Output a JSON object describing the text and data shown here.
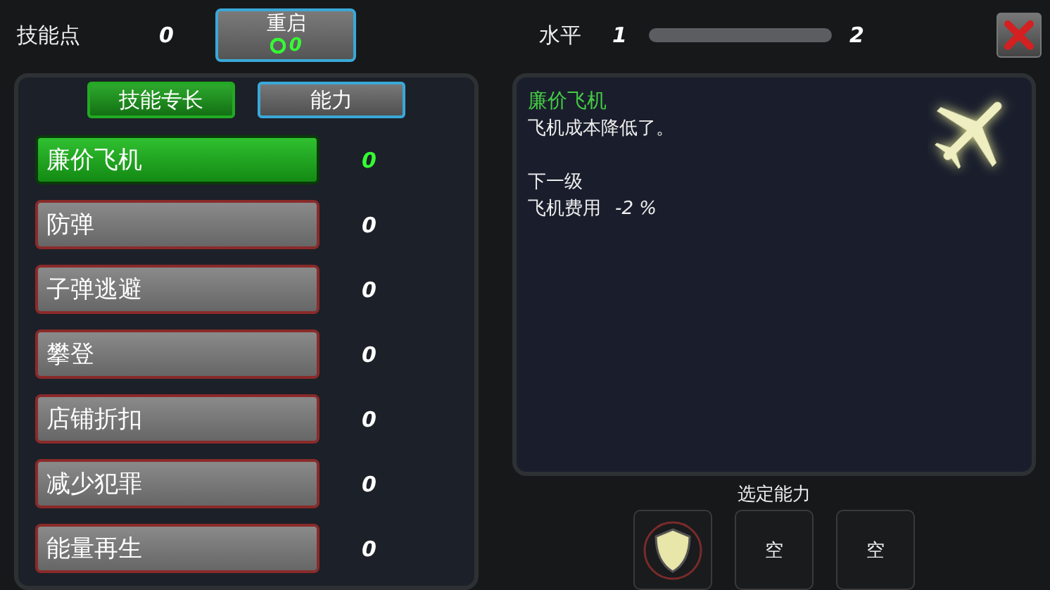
{
  "skill_points": {
    "label": "技能点",
    "value": "0"
  },
  "reset_button": {
    "label": "重启",
    "cost": "0"
  },
  "level": {
    "label": "水平",
    "current": "1",
    "next": "2",
    "level": 0
  },
  "tabs": [
    {
      "label": "技能专长",
      "selected": true
    },
    {
      "label": "能力",
      "selected": false
    }
  ],
  "skills": [
    {
      "name": "廉价飞机",
      "value": "0",
      "selected": true
    },
    {
      "name": "防弹",
      "value": "0",
      "selected": false
    },
    {
      "name": "子弹逃避",
      "value": "0",
      "selected": false
    },
    {
      "name": "攀登",
      "value": "0",
      "selected": false
    },
    {
      "name": "店铺折扣",
      "value": "0",
      "selected": false
    },
    {
      "name": "减少犯罪",
      "value": "0",
      "selected": false
    },
    {
      "name": "能量再生",
      "value": "0",
      "selected": false
    }
  ],
  "detail": {
    "title": "廉价飞机",
    "description": "飞机成本降低了。",
    "next_heading": "下一级",
    "effect_label": "飞机费用",
    "effect_value": "-2 %"
  },
  "selected_abilities": {
    "label": "选定能力",
    "slots": [
      {
        "kind": "icon"
      },
      {
        "kind": "empty",
        "label": "空"
      },
      {
        "kind": "empty",
        "label": "空"
      }
    ]
  }
}
